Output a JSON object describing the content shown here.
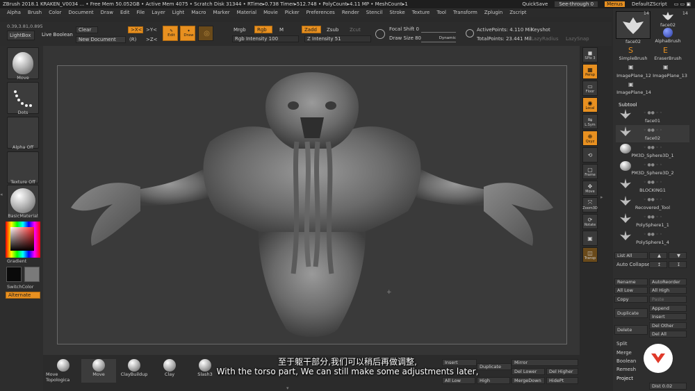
{
  "titlebar": {
    "text": "ZBrush 2018.1   KRAKEN_V0034   ...  • Free Mem 50.052GB • Active Mem 4075 • Scratch Disk 31344 • RTime▸0.738 Timer▸512.748 • PolyCount▸4.11 MP   • MeshCount▸1",
    "quicksave": "QuickSave",
    "seethrough": "See-through",
    "seethrough_val": "0",
    "menus": "Menus",
    "script": "DefaultZScript"
  },
  "menubar": [
    "Alpha",
    "Brush",
    "Color",
    "Document",
    "Draw",
    "Edit",
    "File",
    "Layer",
    "Light",
    "Macro",
    "Marker",
    "Material",
    "Movie",
    "Picker",
    "Preferences",
    "Render",
    "Stencil",
    "Stroke",
    "Texture",
    "Tool",
    "Transform",
    "Zplugin",
    "Zscript"
  ],
  "coords": "0.39,3.81,0.895",
  "shelf": {
    "lightbox": "LightBox",
    "liveboolean": "Live Boolean",
    "clear": "Clear",
    "newdoc": "New Document",
    "x_pos": ">X<",
    "y_pos": ">Y<",
    "r_label": "(R)",
    "z_pos": ">Z<",
    "edit": "Edit",
    "draw": "Draw",
    "mrgb": "Mrgb",
    "rgb": "Rgb",
    "m": "M",
    "rgb_intensity": "Rgb Intensity 100",
    "zadd": "Zadd",
    "zsub": "Zsub",
    "zcut": "Zcut",
    "z_intensity": "Z Intensity 51",
    "focal_shift": "Focal Shift 0",
    "draw_size": "Draw Size 80",
    "dynamic": "Dynamic",
    "active_points": "ActivePoints: 4.110 Mil",
    "total_points": "TotalPoints: 23.441 Mil",
    "keyshot": "Keyshot",
    "lazyradius": "LazyRadius",
    "lazysnap": "LazySnap"
  },
  "leftpanel": {
    "move": "Move",
    "dots": "Dots",
    "alpha_off": "Alpha Off",
    "texture_off": "Texture Off",
    "material": "BasicMaterial",
    "gradient": "Gradient",
    "switchcolor": "SwitchColor",
    "alternate": "Alternate"
  },
  "righttools": [
    "SPix 3",
    "Persp",
    "Floor",
    "Local",
    "L.Sym",
    "Qxyz",
    "",
    "Frame",
    "Move",
    "Zoom3D",
    "Rotate",
    "",
    "Transp"
  ],
  "rpanel": {
    "brush_count": "14",
    "brushes": [
      "face02",
      "face02",
      "AlphaBrush",
      "SimpleBrush",
      "EraserBrush",
      "ImagePlane_12",
      "ImagePlane_13",
      "ImagePlane_14"
    ],
    "subtool_header": "Subtool",
    "subtools": [
      "face01",
      "face02",
      "PM3D_Sphere3D_1",
      "PM3D_Sphere3D_2",
      "BLOCKING1",
      "Recovered_Tool",
      "PolySphere1_1",
      "PolySphere1_4"
    ],
    "list_all": "List All",
    "auto_collapse": "Auto Collapse",
    "rename": "Rename",
    "autoreorder": "AutoReorder",
    "all_low": "All Low",
    "all_high": "All High",
    "copy": "Copy",
    "paste": "Paste",
    "append": "Append",
    "duplicate": "Duplicate",
    "insert": "Insert",
    "delete": "Delete",
    "del_other": "Del Other",
    "del_all": "Del All",
    "split": "Split",
    "merge": "Merge",
    "boolean": "Boolean",
    "remesh": "Remesh",
    "project": "Project",
    "dist": "Dist 0.02"
  },
  "bottombar": {
    "brushes": [
      "Move Topologica",
      "Move",
      "ClayBuildup",
      "Clay",
      "Slash3",
      "",
      "",
      ""
    ],
    "insert": "Insert",
    "duplicate": "Duplicate",
    "mirror": "Mirror",
    "del_lower": "Del Lower",
    "del_higher": "Del Higher",
    "merge_down": "MergeDown",
    "hide_pt": "HidePt",
    "all_low": "All Low",
    "high": "High"
  },
  "subtitles": {
    "chinese": "至于躯干部分,我们可以稍后再做调整,",
    "english": "With the torso part, We can still make some adjustments later,"
  },
  "colors": {
    "accent": "#e89020",
    "panel": "#2e2e2e",
    "viewport": "#353535",
    "logo_red": "#e03a2a"
  }
}
